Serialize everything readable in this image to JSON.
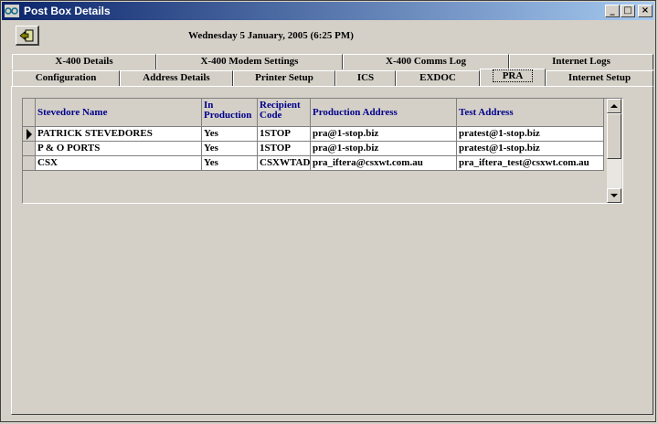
{
  "window": {
    "title": "Post Box Details",
    "min": "_",
    "max": "□",
    "close": "×"
  },
  "header": {
    "datetime": "Wednesday 5 January, 2005  (6:25 PM)"
  },
  "tabs_back": [
    "X-400 Details",
    "X-400 Modem Settings",
    "X-400 Comms Log",
    "Internet Logs"
  ],
  "tabs_front": [
    "Configuration",
    "Address Details",
    "Printer Setup",
    "ICS",
    "EXDOC",
    "PRA",
    "Internet Setup"
  ],
  "active_tab": "PRA",
  "grid": {
    "headers": [
      "Stevedore Name",
      "In Production",
      "Recipient Code",
      "Production Address",
      "Test Address"
    ],
    "rows": [
      [
        "PATRICK STEVEDORES",
        "Yes",
        "1STOP",
        "pra@1-stop.biz",
        "pratest@1-stop.biz"
      ],
      [
        "P & O PORTS",
        "Yes",
        "1STOP",
        "pra@1-stop.biz",
        "pratest@1-stop.biz"
      ],
      [
        "CSX",
        "Yes",
        "CSXWTAD",
        "pra_iftera@csxwt.com.au",
        "pra_iftera_test@csxwt.com.au"
      ]
    ]
  }
}
